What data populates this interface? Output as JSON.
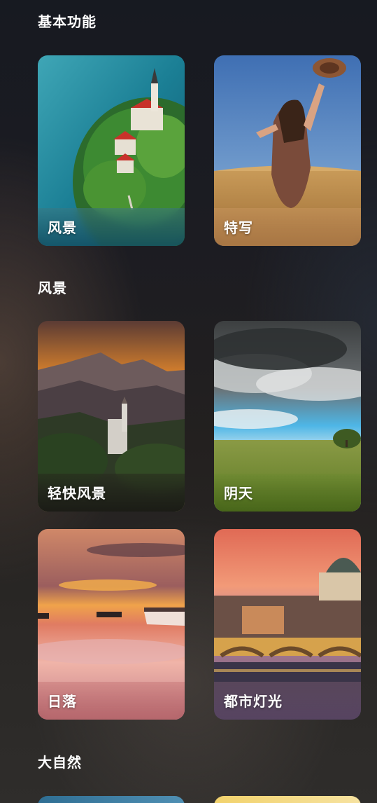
{
  "sections": [
    {
      "title": "基本功能",
      "items": [
        {
          "label": "风景",
          "image": "lake-island-church-photo"
        },
        {
          "label": "特写",
          "image": "woman-wheat-field-hat-photo"
        }
      ]
    },
    {
      "title": "风景",
      "items": [
        {
          "label": "轻快风景",
          "image": "mountain-castle-sunset-photo"
        },
        {
          "label": "阴天",
          "image": "storm-clouds-meadow-photo"
        },
        {
          "label": "日落",
          "image": "sunset-lake-boats-photo"
        },
        {
          "label": "都市灯光",
          "image": "city-bridge-dome-dusk-photo"
        }
      ]
    },
    {
      "title": "大自然",
      "items": [
        {
          "label": "",
          "image": "nature-photo-partial-left"
        },
        {
          "label": "",
          "image": "nature-photo-partial-right"
        }
      ]
    }
  ]
}
